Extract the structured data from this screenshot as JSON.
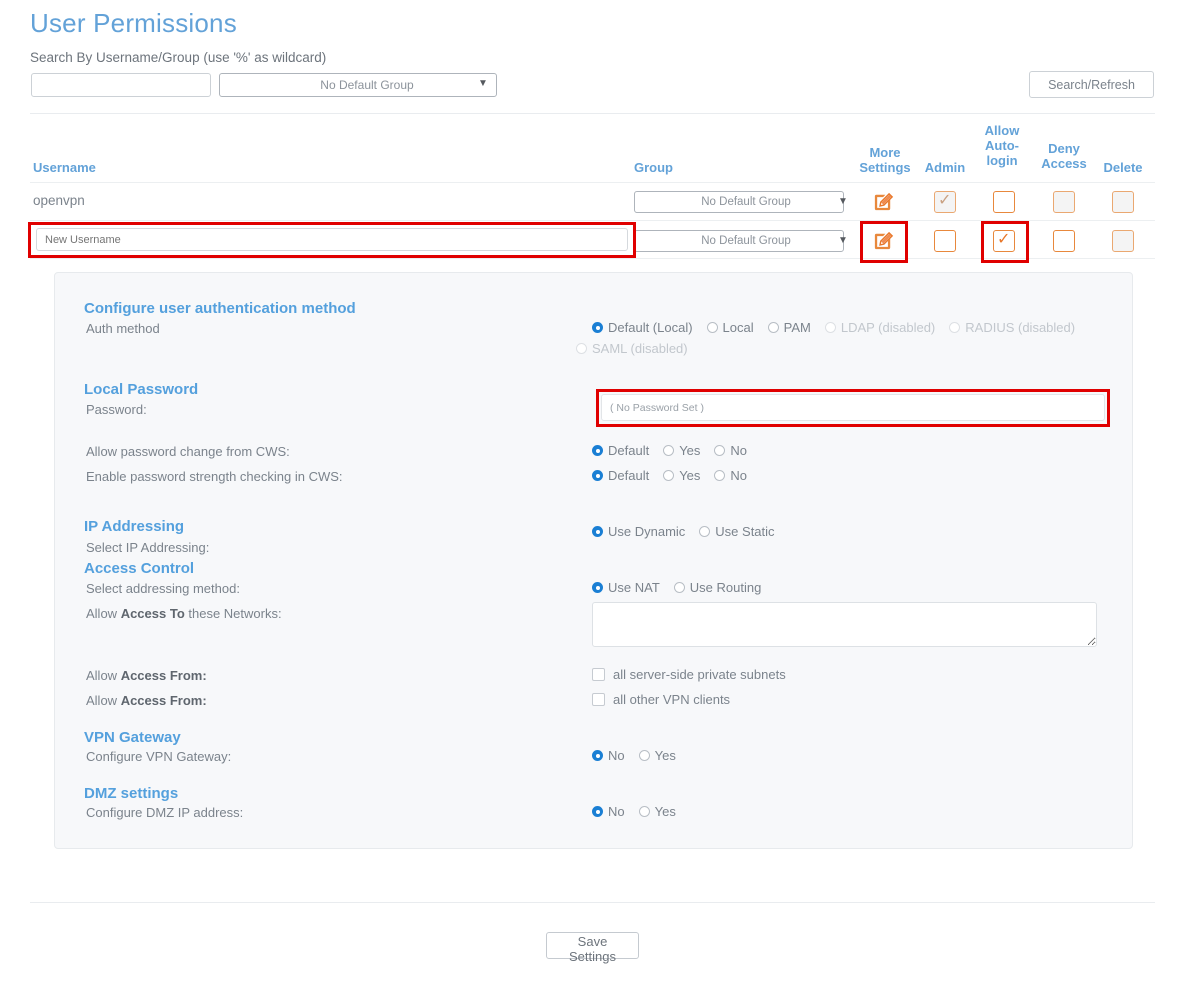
{
  "page": {
    "title": "User Permissions",
    "search_label": "Search By Username/Group (use '%' as wildcard)",
    "search_value": "",
    "search_placeholder": "",
    "search_group_selected": "No Default Group",
    "search_button": "Search/Refresh",
    "save_button": "Save Settings"
  },
  "table": {
    "headers": {
      "username": "Username",
      "group": "Group",
      "more_settings": "More Settings",
      "admin": "Admin",
      "allow_auto_login": "Allow Auto- login",
      "deny_access": "Deny Access",
      "delete": "Delete"
    },
    "header_lines": {
      "more_l1": "More",
      "more_l2": "Settings",
      "admin_l1": "Admin",
      "auto_l1": "Allow",
      "auto_l2": "Auto-",
      "auto_l3": "login",
      "deny_l1": "Deny",
      "deny_l2": "Access",
      "delete_l1": "Delete"
    },
    "rows": [
      {
        "username": "openvpn",
        "group": "No Default Group",
        "admin_checked": true,
        "admin_disabled": true,
        "auto_login_checked": false,
        "auto_login_disabled": false,
        "deny_access_checked": false,
        "deny_access_disabled": true,
        "delete_checked": false,
        "delete_disabled": true
      },
      {
        "username": "",
        "username_placeholder": "New Username",
        "group": "No Default Group",
        "admin_checked": false,
        "admin_disabled": false,
        "auto_login_checked": true,
        "auto_login_disabled": false,
        "deny_access_checked": false,
        "deny_access_disabled": false,
        "delete_checked": false,
        "delete_disabled": true
      }
    ]
  },
  "panel": {
    "auth": {
      "title": "Configure user authentication method",
      "label": "Auth method",
      "options": [
        {
          "label": "Default (Local)",
          "selected": true,
          "disabled": false
        },
        {
          "label": "Local",
          "selected": false,
          "disabled": false
        },
        {
          "label": "PAM",
          "selected": false,
          "disabled": false
        },
        {
          "label": "LDAP (disabled)",
          "selected": false,
          "disabled": true
        },
        {
          "label": "RADIUS (disabled)",
          "selected": false,
          "disabled": true
        },
        {
          "label": "SAML (disabled)",
          "selected": false,
          "disabled": true
        }
      ]
    },
    "local_password": {
      "title": "Local Password",
      "password_label": "Password:",
      "password_value": "( No Password Set )",
      "allow_change_label": "Allow password change from CWS:",
      "allow_change_options": [
        {
          "label": "Default",
          "selected": true
        },
        {
          "label": "Yes",
          "selected": false
        },
        {
          "label": "No",
          "selected": false
        }
      ],
      "strength_label": "Enable password strength checking in CWS:",
      "strength_options": [
        {
          "label": "Default",
          "selected": true
        },
        {
          "label": "Yes",
          "selected": false
        },
        {
          "label": "No",
          "selected": false
        }
      ]
    },
    "ip_addressing": {
      "title": "IP Addressing",
      "label": "Select IP Addressing:",
      "options": [
        {
          "label": "Use Dynamic",
          "selected": true
        },
        {
          "label": "Use Static",
          "selected": false
        }
      ]
    },
    "access_control": {
      "title": "Access Control",
      "method_label": "Select addressing method:",
      "method_options": [
        {
          "label": "Use NAT",
          "selected": true
        },
        {
          "label": "Use Routing",
          "selected": false
        }
      ],
      "access_to_label_pre": "Allow ",
      "access_to_label_bold": "Access To",
      "access_to_label_post": " these Networks:",
      "access_to_value": "",
      "access_from_label_pre": "Allow ",
      "access_from_label_bold": "Access From:",
      "access_from_1": {
        "label": "all server-side private subnets",
        "checked": false
      },
      "access_from_2": {
        "label": "all other VPN clients",
        "checked": false
      }
    },
    "vpn_gateway": {
      "title": "VPN Gateway",
      "label": "Configure VPN Gateway:",
      "options": [
        {
          "label": "No",
          "selected": true
        },
        {
          "label": "Yes",
          "selected": false
        }
      ]
    },
    "dmz": {
      "title": "DMZ settings",
      "label": "Configure DMZ IP address:",
      "options": [
        {
          "label": "No",
          "selected": true
        },
        {
          "label": "Yes",
          "selected": false
        }
      ]
    }
  },
  "annotations": {
    "highlight_color": "#e00000",
    "boxes": [
      "new-username-field",
      "more-settings-row2",
      "allow-auto-login-row2",
      "password-field"
    ]
  },
  "colors": {
    "heading_blue": "#63a2d8",
    "accent_orange": "#e8883c",
    "radio_blue": "#1a7fd4",
    "text_grey": "#6d747c"
  }
}
